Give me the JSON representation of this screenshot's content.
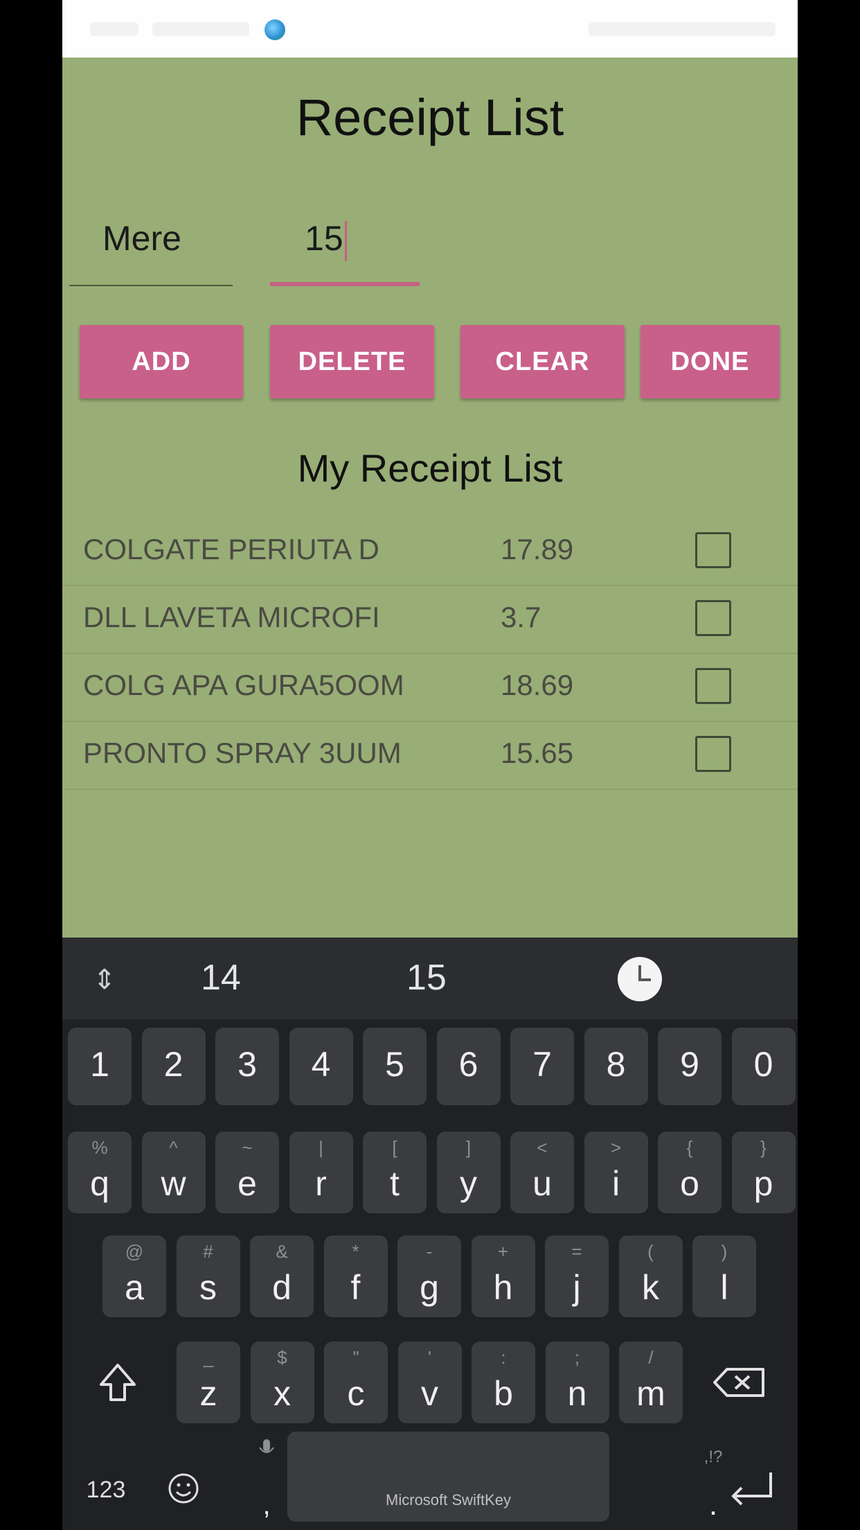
{
  "app": {
    "title": "Receipt List",
    "name_field": {
      "value": "Mere"
    },
    "price_field": {
      "value": "15"
    },
    "buttons": {
      "add": "ADD",
      "delete": "DELETE",
      "clear": "CLEAR",
      "done": "DONE"
    },
    "list_title": "My Receipt List",
    "items": [
      {
        "name": "COLGATE PERIUTA D",
        "price": "17.89",
        "checked": false
      },
      {
        "name": "DLL LAVETA MICROFI",
        "price": "3.7",
        "checked": false
      },
      {
        "name": "COLG APA GURA5OOM",
        "price": "18.69",
        "checked": false
      },
      {
        "name": "PRONTO SPRAY 3UUM",
        "price": "15.65",
        "checked": false
      }
    ]
  },
  "keyboard": {
    "suggestions": [
      "14",
      "15"
    ],
    "number_row": [
      "1",
      "2",
      "3",
      "4",
      "5",
      "6",
      "7",
      "8",
      "9",
      "0"
    ],
    "row1": [
      [
        "q",
        "%"
      ],
      [
        "w",
        "^"
      ],
      [
        "e",
        "~"
      ],
      [
        "r",
        "|"
      ],
      [
        "t",
        "["
      ],
      [
        "y",
        "]"
      ],
      [
        "u",
        "<"
      ],
      [
        "i",
        ">"
      ],
      [
        "o",
        "{"
      ],
      [
        "p",
        "}"
      ]
    ],
    "row2": [
      [
        "a",
        "@"
      ],
      [
        "s",
        "#"
      ],
      [
        "d",
        "&"
      ],
      [
        "f",
        "*"
      ],
      [
        "g",
        "-"
      ],
      [
        "h",
        "+"
      ],
      [
        "j",
        "="
      ],
      [
        "k",
        "("
      ],
      [
        "l",
        ")"
      ]
    ],
    "row3": [
      [
        "z",
        "_"
      ],
      [
        "x",
        "$"
      ],
      [
        "c",
        "\""
      ],
      [
        "v",
        "'"
      ],
      [
        "b",
        ":"
      ],
      [
        "n",
        ";"
      ],
      [
        "m",
        "/"
      ]
    ],
    "bottom": {
      "numbers_key": "123",
      "comma": ",",
      "period": ".",
      "period_hint": ",!?",
      "space_brand": "Microsoft SwiftKey"
    },
    "icons": {
      "expand": "expand-icon",
      "clock": "clock-icon",
      "shift": "shift-icon",
      "backspace": "backspace-icon",
      "emoji": "emoji-icon",
      "mic": "mic-icon",
      "enter": "enter-icon"
    }
  }
}
